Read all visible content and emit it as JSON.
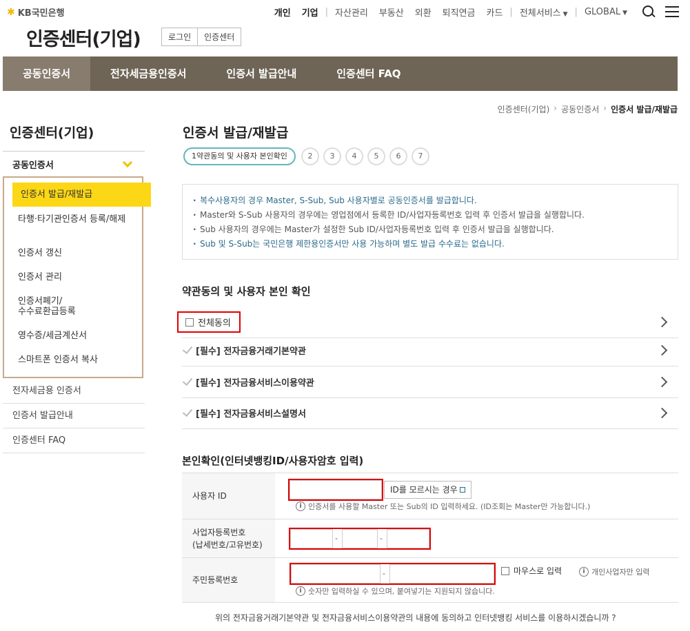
{
  "brand": {
    "logo_mark": "✱",
    "logo_text": "KB국민은행"
  },
  "site_title": "인증센터(기업)",
  "title_links": [
    "로그인",
    "인증센터"
  ],
  "topnav": {
    "personal": "개인",
    "corporate": "기업",
    "items": [
      "자산관리",
      "부동산",
      "외환",
      "퇴직연금",
      "카드"
    ],
    "all_services": "전체서비스",
    "global": "GLOBAL"
  },
  "mainnav": [
    "공동인증서",
    "전자세금용인증서",
    "인증서 발급안내",
    "인증센터 FAQ"
  ],
  "breadcrumb": [
    "인증센터(기업)",
    "공동인증서",
    "인증서 발급/재발급"
  ],
  "sidebar": {
    "title": "인증센터(기업)",
    "group": "공동인증서",
    "sub_items": [
      "인증서 발급/재발급",
      "타행·타기관인증서 등록/해제",
      "인증서 갱신",
      "인증서 관리",
      "인증서폐기/\n수수료환급등록",
      "영수증/세금계산서",
      "스마트폰 인증서 복사"
    ],
    "items": [
      "전자세금용 인증서",
      "인증서 발급안내",
      "인증센터 FAQ"
    ]
  },
  "page_title": "인증서 발급/재발급",
  "steps": {
    "active": "1약관동의 및 사용자 본인확인",
    "others": [
      "2",
      "3",
      "4",
      "5",
      "6",
      "7"
    ]
  },
  "notices": [
    "복수사용자의 경우 Master, S-Sub, Sub 사용자별로 공동인증서를 발급합니다.",
    "Master와 S-Sub 사용자의 경우에는 영업점에서 등록한 ID/사업자등록번호 입력 후 인증서 발급을 실행합니다.",
    "Sub 사용자의 경우에는 Master가 설정한 Sub ID/사업자등록번호 입력 후 인증서 발급을 실행합니다.",
    "Sub 및 S-Sub는 국민은행 제한용인증서만 사용 가능하며 별도 발급 수수료는 없습니다."
  ],
  "agree_section": {
    "title": "약관동의 및 사용자 본인 확인",
    "all": "전체동의",
    "terms": [
      "[필수] 전자금융거래기본약관",
      "[필수] 전자금융서비스이용약관",
      "[필수] 전자금융서비스설명서"
    ]
  },
  "identity_section": {
    "title": "본인확인(인터넷뱅킹ID/사용자암호 입력)",
    "user_id_label": "사용자 ID",
    "id_help_button": "ID를 모르시는 경우",
    "id_info": "인증서를 사용할 Master 또는 Sub의 ID 입력하세요. (ID조회는 Master만 가능합니다.)",
    "biz_label_1": "사업자등록번호",
    "biz_label_2": "(납세번호/고유번호)",
    "rrn_label": "주민등록번호",
    "mouse_input": "마우스로 입력",
    "individual_only": "개인사업자만 입력",
    "rrn_info": "숫자만 입력하실 수 있으며, 붙여넣기는 지원되지 않습니다.",
    "dash": "-"
  },
  "bottom_question": "위의 전자금융거래기본약관 및 전자금융서비스이용약관의 내용에 동의하고 인터넷뱅킹 서비스를 이용하시겠습니까 ?"
}
